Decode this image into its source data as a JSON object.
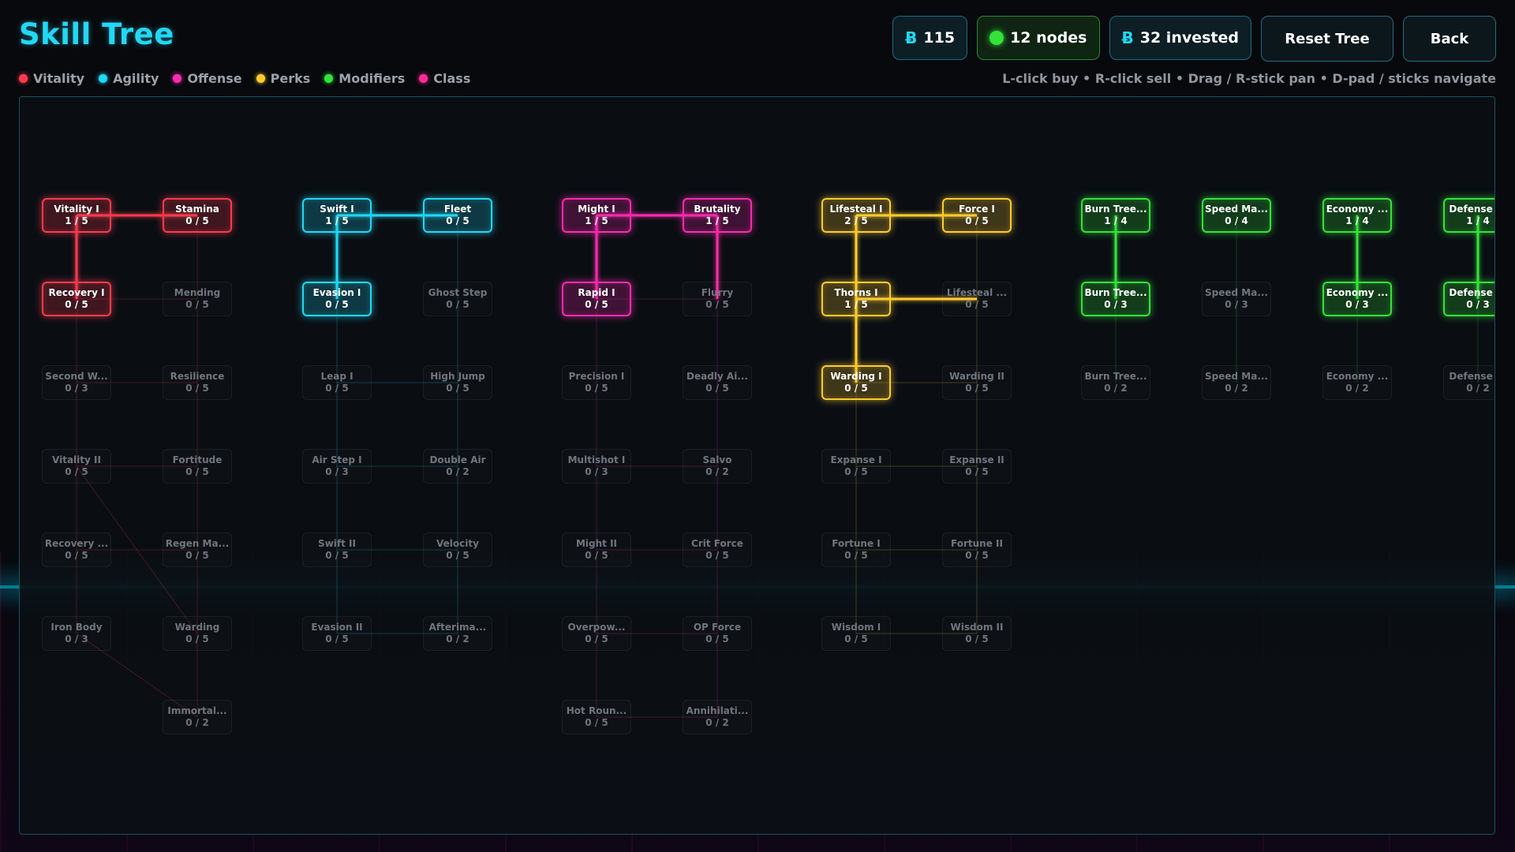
{
  "header": {
    "title": "Skill Tree",
    "currency": "115",
    "nodes": "12 nodes",
    "invested": "32 invested",
    "reset_label": "Reset Tree",
    "back_label": "Back",
    "hint": "L-click buy • R-click sell • Drag / R-stick pan • D-pad / sticks navigate",
    "currency_icon": "Ƀ"
  },
  "legend": [
    {
      "label": "Vitality",
      "color": "#ff3b4e"
    },
    {
      "label": "Agility",
      "color": "#22d8f5"
    },
    {
      "label": "Offense",
      "color": "#ff2bb0"
    },
    {
      "label": "Perks",
      "color": "#ffcc30"
    },
    {
      "label": "Modifiers",
      "color": "#35e23a"
    },
    {
      "label": "Class",
      "color": "#ff2b9a"
    }
  ],
  "branch_colors": {
    "vitality": "#ff3b4e",
    "agility": "#22d8f5",
    "offense": "#ff2bb0",
    "perks": "#ffcc30",
    "modifiers": "#35e23a"
  },
  "nodes": [
    {
      "id": "v1",
      "name": "Vitality I",
      "level": "1 / 5",
      "branch": "vitality",
      "owned": true
    },
    {
      "id": "v2",
      "name": "Stamina",
      "level": "0 / 5",
      "branch": "vitality",
      "owned": true
    },
    {
      "id": "v3",
      "name": "Recovery I",
      "level": "0 / 5",
      "branch": "vitality",
      "owned": true
    },
    {
      "id": "v4",
      "name": "Mending",
      "level": "0 / 5",
      "branch": "vitality",
      "owned": false
    },
    {
      "id": "v5",
      "name": "Second W...",
      "level": "0 / 3",
      "branch": "vitality",
      "owned": false
    },
    {
      "id": "v6",
      "name": "Resilience",
      "level": "0 / 5",
      "branch": "vitality",
      "owned": false
    },
    {
      "id": "v7",
      "name": "Vitality II",
      "level": "0 / 5",
      "branch": "vitality",
      "owned": false
    },
    {
      "id": "v8",
      "name": "Fortitude",
      "level": "0 / 5",
      "branch": "vitality",
      "owned": false
    },
    {
      "id": "v9",
      "name": "Recovery ...",
      "level": "0 / 5",
      "branch": "vitality",
      "owned": false
    },
    {
      "id": "v10",
      "name": "Regen Ma...",
      "level": "0 / 5",
      "branch": "vitality",
      "owned": false
    },
    {
      "id": "v11",
      "name": "Iron Body",
      "level": "0 / 3",
      "branch": "vitality",
      "owned": false
    },
    {
      "id": "v12",
      "name": "Warding",
      "level": "0 / 5",
      "branch": "vitality",
      "owned": false
    },
    {
      "id": "v13",
      "name": "Immortal...",
      "level": "0 / 2",
      "branch": "vitality",
      "owned": false
    },
    {
      "id": "a1",
      "name": "Swift I",
      "level": "1 / 5",
      "branch": "agility",
      "owned": true
    },
    {
      "id": "a2",
      "name": "Fleet",
      "level": "0 / 5",
      "branch": "agility",
      "owned": true
    },
    {
      "id": "a3",
      "name": "Evasion I",
      "level": "0 / 5",
      "branch": "agility",
      "owned": true
    },
    {
      "id": "a4",
      "name": "Ghost Step",
      "level": "0 / 5",
      "branch": "agility",
      "owned": false
    },
    {
      "id": "a5",
      "name": "Leap I",
      "level": "0 / 5",
      "branch": "agility",
      "owned": false
    },
    {
      "id": "a6",
      "name": "High Jump",
      "level": "0 / 5",
      "branch": "agility",
      "owned": false
    },
    {
      "id": "a7",
      "name": "Air Step I",
      "level": "0 / 3",
      "branch": "agility",
      "owned": false
    },
    {
      "id": "a8",
      "name": "Double Air",
      "level": "0 / 2",
      "branch": "agility",
      "owned": false
    },
    {
      "id": "a9",
      "name": "Swift II",
      "level": "0 / 5",
      "branch": "agility",
      "owned": false
    },
    {
      "id": "a10",
      "name": "Velocity",
      "level": "0 / 5",
      "branch": "agility",
      "owned": false
    },
    {
      "id": "a11",
      "name": "Evasion II",
      "level": "0 / 5",
      "branch": "agility",
      "owned": false
    },
    {
      "id": "a12",
      "name": "Afterima...",
      "level": "0 / 2",
      "branch": "agility",
      "owned": false
    },
    {
      "id": "o1",
      "name": "Might I",
      "level": "1 / 5",
      "branch": "offense",
      "owned": true
    },
    {
      "id": "o2",
      "name": "Brutality",
      "level": "1 / 5",
      "branch": "offense",
      "owned": true
    },
    {
      "id": "o3",
      "name": "Rapid I",
      "level": "0 / 5",
      "branch": "offense",
      "owned": true
    },
    {
      "id": "o4",
      "name": "Flurry",
      "level": "0 / 5",
      "branch": "offense",
      "owned": false
    },
    {
      "id": "o5",
      "name": "Precision I",
      "level": "0 / 5",
      "branch": "offense",
      "owned": false
    },
    {
      "id": "o6",
      "name": "Deadly Ai...",
      "level": "0 / 5",
      "branch": "offense",
      "owned": false
    },
    {
      "id": "o7",
      "name": "Multishot I",
      "level": "0 / 3",
      "branch": "offense",
      "owned": false
    },
    {
      "id": "o8",
      "name": "Salvo",
      "level": "0 / 2",
      "branch": "offense",
      "owned": false
    },
    {
      "id": "o9",
      "name": "Might II",
      "level": "0 / 5",
      "branch": "offense",
      "owned": false
    },
    {
      "id": "o10",
      "name": "Crit Force",
      "level": "0 / 5",
      "branch": "offense",
      "owned": false
    },
    {
      "id": "o11",
      "name": "Overpow...",
      "level": "0 / 5",
      "branch": "offense",
      "owned": false
    },
    {
      "id": "o12",
      "name": "OP Force",
      "level": "0 / 5",
      "branch": "offense",
      "owned": false
    },
    {
      "id": "o13",
      "name": "Hot Roun...",
      "level": "0 / 5",
      "branch": "offense",
      "owned": false
    },
    {
      "id": "o14",
      "name": "Annihilati...",
      "level": "0 / 2",
      "branch": "offense",
      "owned": false
    },
    {
      "id": "p1",
      "name": "Lifesteal I",
      "level": "2 / 5",
      "branch": "perks",
      "owned": true
    },
    {
      "id": "p2",
      "name": "Force I",
      "level": "0 / 5",
      "branch": "perks",
      "owned": true
    },
    {
      "id": "p3",
      "name": "Thorns I",
      "level": "1 / 5",
      "branch": "perks",
      "owned": true
    },
    {
      "id": "p4",
      "name": "Lifesteal ...",
      "level": "0 / 5",
      "branch": "perks",
      "owned": false
    },
    {
      "id": "p5",
      "name": "Warding I",
      "level": "0 / 5",
      "branch": "perks",
      "owned": true
    },
    {
      "id": "p6",
      "name": "Warding II",
      "level": "0 / 5",
      "branch": "perks",
      "owned": false
    },
    {
      "id": "p7",
      "name": "Expanse I",
      "level": "0 / 5",
      "branch": "perks",
      "owned": false
    },
    {
      "id": "p8",
      "name": "Expanse II",
      "level": "0 / 5",
      "branch": "perks",
      "owned": false
    },
    {
      "id": "p9",
      "name": "Fortune I",
      "level": "0 / 5",
      "branch": "perks",
      "owned": false
    },
    {
      "id": "p10",
      "name": "Fortune II",
      "level": "0 / 5",
      "branch": "perks",
      "owned": false
    },
    {
      "id": "p11",
      "name": "Wisdom I",
      "level": "0 / 5",
      "branch": "perks",
      "owned": false
    },
    {
      "id": "p12",
      "name": "Wisdom II",
      "level": "0 / 5",
      "branch": "perks",
      "owned": false
    },
    {
      "id": "m1",
      "name": "Burn Tree...",
      "level": "1 / 4",
      "branch": "modifiers",
      "owned": true
    },
    {
      "id": "m2",
      "name": "Burn Tree...",
      "level": "0 / 3",
      "branch": "modifiers",
      "owned": true
    },
    {
      "id": "m3",
      "name": "Burn Tree...",
      "level": "0 / 2",
      "branch": "modifiers",
      "owned": false
    },
    {
      "id": "m4",
      "name": "Speed Ma...",
      "level": "0 / 4",
      "branch": "modifiers",
      "owned": true
    },
    {
      "id": "m5",
      "name": "Speed Ma...",
      "level": "0 / 3",
      "branch": "modifiers",
      "owned": false
    },
    {
      "id": "m6",
      "name": "Speed Ma...",
      "level": "0 / 2",
      "branch": "modifiers",
      "owned": false
    },
    {
      "id": "m7",
      "name": "Economy ...",
      "level": "1 / 4",
      "branch": "modifiers",
      "owned": true
    },
    {
      "id": "m8",
      "name": "Economy ...",
      "level": "0 / 3",
      "branch": "modifiers",
      "owned": true
    },
    {
      "id": "m9",
      "name": "Economy ...",
      "level": "0 / 2",
      "branch": "modifiers",
      "owned": false
    },
    {
      "id": "m10",
      "name": "Defense ...",
      "level": "1 / 4",
      "branch": "modifiers",
      "owned": true
    },
    {
      "id": "m11",
      "name": "Defense ...",
      "level": "0 / 3",
      "branch": "modifiers",
      "owned": true
    },
    {
      "id": "m12",
      "name": "Defense ...",
      "level": "0 / 2",
      "branch": "modifiers",
      "owned": false
    }
  ],
  "links": [
    {
      "from": "v1",
      "to": "v2",
      "active": true
    },
    {
      "from": "v1",
      "to": "v3",
      "active": true
    },
    {
      "from": "v2",
      "to": "v4",
      "active": false
    },
    {
      "from": "v3",
      "to": "v4",
      "active": false
    },
    {
      "from": "v3",
      "to": "v5",
      "active": false
    },
    {
      "from": "v4",
      "to": "v6",
      "active": false
    },
    {
      "from": "v5",
      "to": "v6",
      "active": false
    },
    {
      "from": "v5",
      "to": "v7",
      "active": false
    },
    {
      "from": "v6",
      "to": "v8",
      "active": false
    },
    {
      "from": "v7",
      "to": "v8",
      "active": false
    },
    {
      "from": "v7",
      "to": "v9",
      "active": false
    },
    {
      "from": "v7",
      "to": "v12",
      "active": false
    },
    {
      "from": "v8",
      "to": "v10",
      "active": false
    },
    {
      "from": "v9",
      "to": "v10",
      "active": false
    },
    {
      "from": "v9",
      "to": "v11",
      "active": false
    },
    {
      "from": "v10",
      "to": "v12",
      "active": false
    },
    {
      "from": "v11",
      "to": "v13",
      "active": false
    },
    {
      "from": "v12",
      "to": "v13",
      "active": false
    },
    {
      "from": "a1",
      "to": "a2",
      "active": true
    },
    {
      "from": "a1",
      "to": "a3",
      "active": true
    },
    {
      "from": "a2",
      "to": "a4",
      "active": false
    },
    {
      "from": "a3",
      "to": "a5",
      "active": false
    },
    {
      "from": "a4",
      "to": "a6",
      "active": false
    },
    {
      "from": "a5",
      "to": "a6",
      "active": false
    },
    {
      "from": "a5",
      "to": "a7",
      "active": false
    },
    {
      "from": "a6",
      "to": "a8",
      "active": false
    },
    {
      "from": "a7",
      "to": "a8",
      "active": false
    },
    {
      "from": "a7",
      "to": "a9",
      "active": false
    },
    {
      "from": "a8",
      "to": "a10",
      "active": false
    },
    {
      "from": "a9",
      "to": "a10",
      "active": false
    },
    {
      "from": "a9",
      "to": "a11",
      "active": false
    },
    {
      "from": "a10",
      "to": "a12",
      "active": false
    },
    {
      "from": "a11",
      "to": "a12",
      "active": false
    },
    {
      "from": "o1",
      "to": "o2",
      "active": true
    },
    {
      "from": "o1",
      "to": "o3",
      "active": true
    },
    {
      "from": "o2",
      "to": "o4",
      "active": true
    },
    {
      "from": "o3",
      "to": "o4",
      "active": false
    },
    {
      "from": "o3",
      "to": "o5",
      "active": false
    },
    {
      "from": "o4",
      "to": "o6",
      "active": false
    },
    {
      "from": "o5",
      "to": "o7",
      "active": false
    },
    {
      "from": "o6",
      "to": "o8",
      "active": false
    },
    {
      "from": "o7",
      "to": "o8",
      "active": false
    },
    {
      "from": "o7",
      "to": "o9",
      "active": false
    },
    {
      "from": "o8",
      "to": "o10",
      "active": false
    },
    {
      "from": "o9",
      "to": "o10",
      "active": false
    },
    {
      "from": "o9",
      "to": "o11",
      "active": false
    },
    {
      "from": "o10",
      "to": "o12",
      "active": false
    },
    {
      "from": "o11",
      "to": "o12",
      "active": false
    },
    {
      "from": "o11",
      "to": "o13",
      "active": false
    },
    {
      "from": "o12",
      "to": "o14",
      "active": false
    },
    {
      "from": "o13",
      "to": "o14",
      "active": false
    },
    {
      "from": "p1",
      "to": "p2",
      "active": true
    },
    {
      "from": "p1",
      "to": "p3",
      "active": true
    },
    {
      "from": "p3",
      "to": "p4",
      "active": true
    },
    {
      "from": "p2",
      "to": "p4",
      "active": false
    },
    {
      "from": "p3",
      "to": "p5",
      "active": true
    },
    {
      "from": "p4",
      "to": "p6",
      "active": false
    },
    {
      "from": "p5",
      "to": "p6",
      "active": false
    },
    {
      "from": "p5",
      "to": "p7",
      "active": false
    },
    {
      "from": "p6",
      "to": "p8",
      "active": false
    },
    {
      "from": "p7",
      "to": "p8",
      "active": false
    },
    {
      "from": "p7",
      "to": "p9",
      "active": false
    },
    {
      "from": "p8",
      "to": "p10",
      "active": false
    },
    {
      "from": "p9",
      "to": "p10",
      "active": false
    },
    {
      "from": "p9",
      "to": "p11",
      "active": false
    },
    {
      "from": "p10",
      "to": "p12",
      "active": false
    },
    {
      "from": "p11",
      "to": "p12",
      "active": false
    },
    {
      "from": "m1",
      "to": "m2",
      "active": true
    },
    {
      "from": "m2",
      "to": "m3",
      "active": false
    },
    {
      "from": "m4",
      "to": "m5",
      "active": false
    },
    {
      "from": "m5",
      "to": "m6",
      "active": false
    },
    {
      "from": "m7",
      "to": "m8",
      "active": true
    },
    {
      "from": "m8",
      "to": "m9",
      "active": false
    },
    {
      "from": "m10",
      "to": "m11",
      "active": true
    },
    {
      "from": "m11",
      "to": "m12",
      "active": false
    }
  ]
}
